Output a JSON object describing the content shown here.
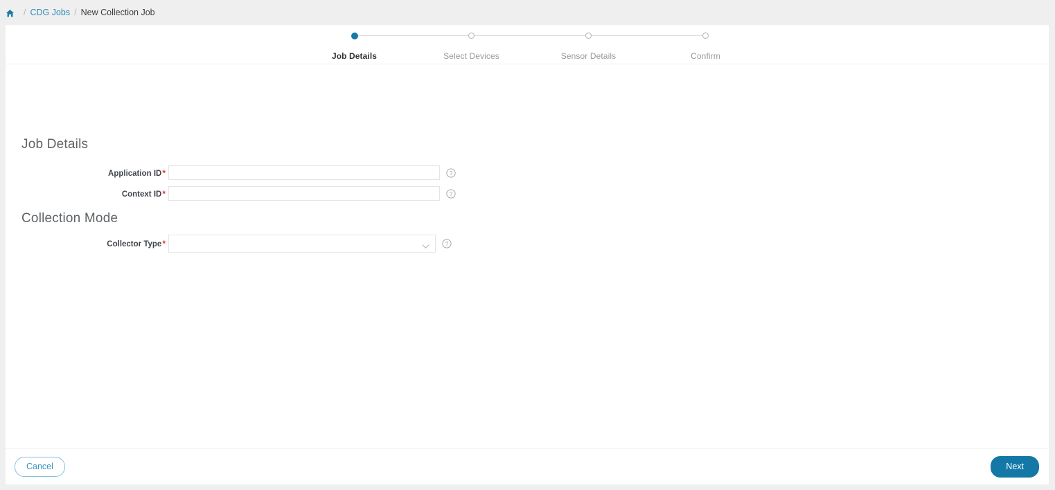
{
  "breadcrumb": {
    "home_icon": "home-icon",
    "separator": "/",
    "link_label": "CDG Jobs",
    "current_label": "New Collection Job"
  },
  "stepper": {
    "steps": [
      {
        "label": "Job Details",
        "state": "active"
      },
      {
        "label": "Select Devices",
        "state": "inactive"
      },
      {
        "label": "Sensor Details",
        "state": "inactive"
      },
      {
        "label": "Confirm",
        "state": "inactive"
      }
    ]
  },
  "sections": {
    "job_details": {
      "title": "Job Details",
      "fields": [
        {
          "label": "Application ID",
          "required_marker": "*",
          "value": "",
          "placeholder": "",
          "help_icon": "help-circle-icon"
        },
        {
          "label": "Context ID",
          "required_marker": "*",
          "value": "",
          "placeholder": "",
          "help_icon": "help-circle-icon"
        }
      ]
    },
    "collection_mode": {
      "title": "Collection Mode",
      "fields": [
        {
          "label": "Collector Type",
          "required_marker": "*",
          "value": "",
          "placeholder": "",
          "dropdown_icon": "chevron-down-icon",
          "help_icon": "help-circle-icon"
        }
      ]
    }
  },
  "footer": {
    "cancel_label": "Cancel",
    "next_label": "Next"
  },
  "colors": {
    "accent_blue": "#1378a6",
    "link_blue": "#2d8cb5",
    "required_red": "#e8302a",
    "page_background": "#efefef",
    "card_background": "#ffffff"
  }
}
